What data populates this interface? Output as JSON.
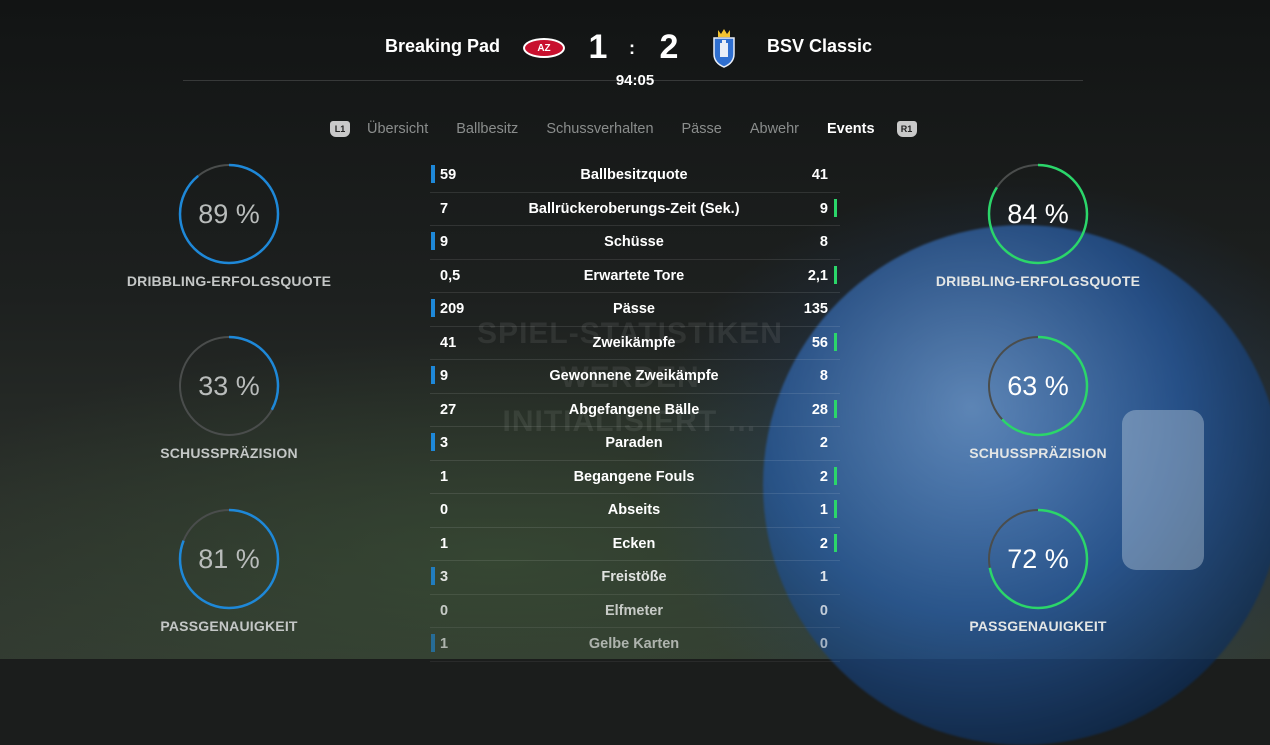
{
  "match": {
    "home_team": "Breaking Pad",
    "home_crest": "AZ",
    "away_team": "BSV Classic",
    "home_score": "1",
    "separator": ":",
    "away_score": "2",
    "clock": "94:05"
  },
  "background": {
    "watermark_line1": "SPIEL-STATISTIKEN WERDEN",
    "watermark_line2": "INITIALISIERT …"
  },
  "tabs": {
    "left_bumper": "L1",
    "right_bumper": "R1",
    "items": [
      "Übersicht",
      "Ballbesitz",
      "Schussverhalten",
      "Pässe",
      "Abwehr",
      "Events"
    ],
    "active": "Events"
  },
  "home_gauges": [
    {
      "value": 0.89,
      "text": "89 %",
      "label": "DRIBBLING-ERFOLGSQUOTE"
    },
    {
      "value": 0.33,
      "text": "33 %",
      "label": "SCHUSSPRÄZISION"
    },
    {
      "value": 0.81,
      "text": "81 %",
      "label": "PASSGENAUIGKEIT"
    }
  ],
  "away_gauges": [
    {
      "value": 0.84,
      "text": "84 %",
      "label": "DRIBBLING-ERFOLGSQUOTE"
    },
    {
      "value": 0.63,
      "text": "63 %",
      "label": "SCHUSSPRÄZISION"
    },
    {
      "value": 0.72,
      "text": "72 %",
      "label": "PASSGENAUIGKEIT"
    }
  ],
  "colors": {
    "home_accent": "#1e88d8",
    "away_accent": "#2bd66a",
    "track": "#4a4d4c"
  },
  "stats": [
    {
      "home": "59",
      "label": "Ballbesitzquote",
      "away": "41",
      "leader": "home"
    },
    {
      "home": "7",
      "label": "Ballrückeroberungs-Zeit (Sek.)",
      "away": "9",
      "leader": "away"
    },
    {
      "home": "9",
      "label": "Schüsse",
      "away": "8",
      "leader": "home"
    },
    {
      "home": "0,5",
      "label": "Erwartete Tore",
      "away": "2,1",
      "leader": "away"
    },
    {
      "home": "209",
      "label": "Pässe",
      "away": "135",
      "leader": "home"
    },
    {
      "home": "41",
      "label": "Zweikämpfe",
      "away": "56",
      "leader": "away"
    },
    {
      "home": "9",
      "label": "Gewonnene Zweikämpfe",
      "away": "8",
      "leader": "home"
    },
    {
      "home": "27",
      "label": "Abgefangene Bälle",
      "away": "28",
      "leader": "away"
    },
    {
      "home": "3",
      "label": "Paraden",
      "away": "2",
      "leader": "home"
    },
    {
      "home": "1",
      "label": "Begangene Fouls",
      "away": "2",
      "leader": "away"
    },
    {
      "home": "0",
      "label": "Abseits",
      "away": "1",
      "leader": "away"
    },
    {
      "home": "1",
      "label": "Ecken",
      "away": "2",
      "leader": "away"
    },
    {
      "home": "3",
      "label": "Freistöße",
      "away": "1",
      "leader": "home"
    },
    {
      "home": "0",
      "label": "Elfmeter",
      "away": "0",
      "leader": "none"
    },
    {
      "home": "1",
      "label": "Gelbe Karten",
      "away": "0",
      "leader": "home"
    }
  ]
}
